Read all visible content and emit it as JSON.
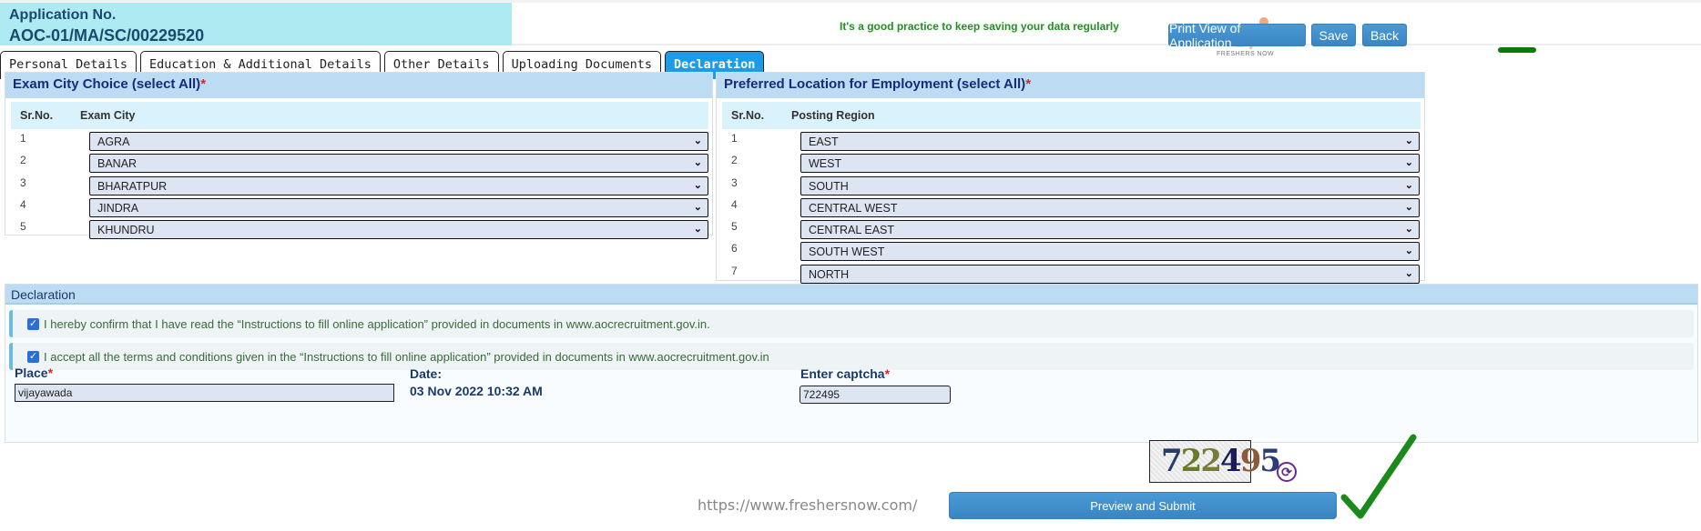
{
  "header": {
    "app_no_label": "Application No.",
    "app_no_value": "AOC-01/MA/SC/00229520",
    "tip": "It's a good practice to keep saving your data regularly",
    "logo_text": "FRESHERS NOW",
    "buttons": {
      "print": "Print View of Application",
      "save": "Save",
      "back": "Back"
    }
  },
  "tabs": [
    {
      "label": "Personal Details",
      "active": false
    },
    {
      "label": "Education & Additional Details",
      "active": false
    },
    {
      "label": "Other Details",
      "active": false
    },
    {
      "label": "Uploading Documents",
      "active": false
    },
    {
      "label": "Declaration",
      "active": true
    }
  ],
  "exam_city": {
    "title": "Exam City Choice (select All)",
    "required": "*",
    "col_srno": "Sr.No.",
    "col_name": "Exam City",
    "rows": [
      {
        "no": "1",
        "value": "AGRA"
      },
      {
        "no": "2",
        "value": "BANAR"
      },
      {
        "no": "3",
        "value": "BHARATPUR"
      },
      {
        "no": "4",
        "value": "JINDRA"
      },
      {
        "no": "5",
        "value": "KHUNDRU"
      }
    ]
  },
  "location": {
    "title": "Preferred Location for Employment (select All)",
    "required": "*",
    "col_srno": "Sr.No.",
    "col_name": "Posting Region",
    "rows": [
      {
        "no": "1",
        "value": "EAST"
      },
      {
        "no": "2",
        "value": "WEST"
      },
      {
        "no": "3",
        "value": "SOUTH"
      },
      {
        "no": "4",
        "value": "CENTRAL WEST"
      },
      {
        "no": "5",
        "value": "CENTRAL EAST"
      },
      {
        "no": "6",
        "value": "SOUTH WEST"
      },
      {
        "no": "7",
        "value": "NORTH"
      }
    ]
  },
  "declaration": {
    "title": "Declaration",
    "statements": [
      {
        "checked": true,
        "text": "I hereby confirm that I have read the “Instructions to fill online application” provided in documents in www.aocrecruitment.gov.in."
      },
      {
        "checked": true,
        "text": "I accept all the terms and conditions given in the “Instructions to fill online application” provided in documents in www.aocrecruitment.gov.in"
      }
    ],
    "place_label": "Place",
    "place_value": "vijayawada",
    "date_label": "Date:",
    "date_value": "03 Nov 2022 10:32 AM",
    "captcha_label": "Enter captcha",
    "captcha_input": "722495",
    "captcha_image_text": "722495",
    "submit_label": "Preview and Submit",
    "required": "*"
  },
  "watermark": "https://www.freshersnow.com/",
  "colors": {
    "accent": "#3a85c2",
    "active_tab": "#1e9be6",
    "required": "#e0202a",
    "check": "#1a8a1a"
  }
}
